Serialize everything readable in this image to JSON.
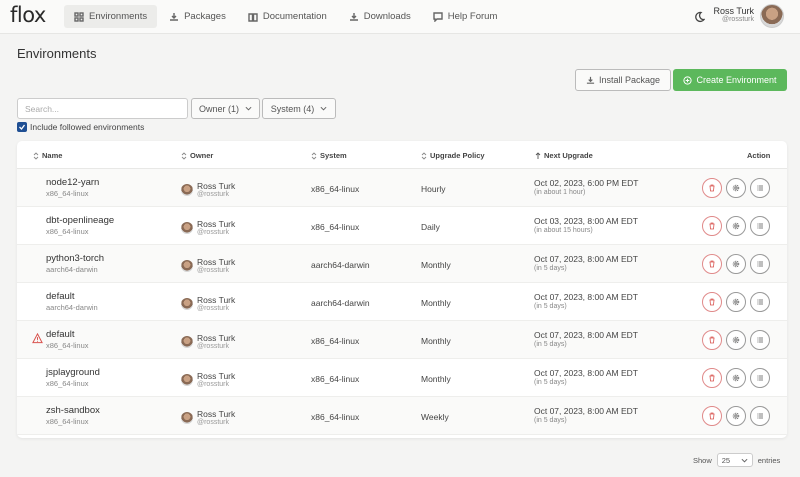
{
  "brand": {
    "logo": "flox"
  },
  "nav": [
    {
      "label": "Environments",
      "icon": "grid-icon",
      "active": true
    },
    {
      "label": "Packages",
      "icon": "download-icon"
    },
    {
      "label": "Documentation",
      "icon": "book-icon"
    },
    {
      "label": "Downloads",
      "icon": "download-icon"
    },
    {
      "label": "Help Forum",
      "icon": "chat-icon"
    }
  ],
  "user": {
    "name": "Ross Turk",
    "handle": "@rossturk"
  },
  "page": {
    "title": "Environments"
  },
  "buttons": {
    "install": "Install Package",
    "create": "Create Environment"
  },
  "filters": {
    "search_placeholder": "Search...",
    "owner": "Owner (1)",
    "system": "System (4)",
    "include_followed": "Include followed environments",
    "include_followed_checked": true
  },
  "table": {
    "headers": {
      "name": "Name",
      "owner": "Owner",
      "system": "System",
      "policy": "Upgrade Policy",
      "next": "Next Upgrade",
      "action": "Action"
    },
    "rows": [
      {
        "name": "node12-yarn",
        "system": "x86_64-linux",
        "owner": "Ross Turk",
        "owner_handle": "@rossturk",
        "policy": "Hourly",
        "next": "Oct 02, 2023, 6:00 PM EDT",
        "next_rel": "(in about 1 hour)",
        "warning": false
      },
      {
        "name": "dbt-openlineage",
        "system": "x86_64-linux",
        "owner": "Ross Turk",
        "owner_handle": "@rossturk",
        "policy": "Daily",
        "next": "Oct 03, 2023, 8:00 AM EDT",
        "next_rel": "(in about 15 hours)",
        "warning": false
      },
      {
        "name": "python3-torch",
        "system": "aarch64-darwin",
        "owner": "Ross Turk",
        "owner_handle": "@rossturk",
        "policy": "Monthly",
        "next": "Oct 07, 2023, 8:00 AM EDT",
        "next_rel": "(in 5 days)",
        "warning": false
      },
      {
        "name": "default",
        "system": "aarch64-darwin",
        "owner": "Ross Turk",
        "owner_handle": "@rossturk",
        "policy": "Monthly",
        "next": "Oct 07, 2023, 8:00 AM EDT",
        "next_rel": "(in 5 days)",
        "warning": false
      },
      {
        "name": "default",
        "system": "x86_64-linux",
        "owner": "Ross Turk",
        "owner_handle": "@rossturk",
        "policy": "Monthly",
        "next": "Oct 07, 2023, 8:00 AM EDT",
        "next_rel": "(in 5 days)",
        "warning": true
      },
      {
        "name": "jsplayground",
        "system": "x86_64-linux",
        "owner": "Ross Turk",
        "owner_handle": "@rossturk",
        "policy": "Monthly",
        "next": "Oct 07, 2023, 8:00 AM EDT",
        "next_rel": "(in 5 days)",
        "warning": false
      },
      {
        "name": "zsh-sandbox",
        "system": "x86_64-linux",
        "owner": "Ross Turk",
        "owner_handle": "@rossturk",
        "policy": "Weekly",
        "next": "Oct 07, 2023, 8:00 AM EDT",
        "next_rel": "(in 5 days)",
        "warning": false
      }
    ]
  },
  "pagination": {
    "show": "Show",
    "per_page": "25",
    "entries": "entries"
  },
  "colors": {
    "primary": "#5cb85c",
    "checkbox": "#1f4f93",
    "danger": "#e08a8a",
    "warning": "#d9534f"
  }
}
